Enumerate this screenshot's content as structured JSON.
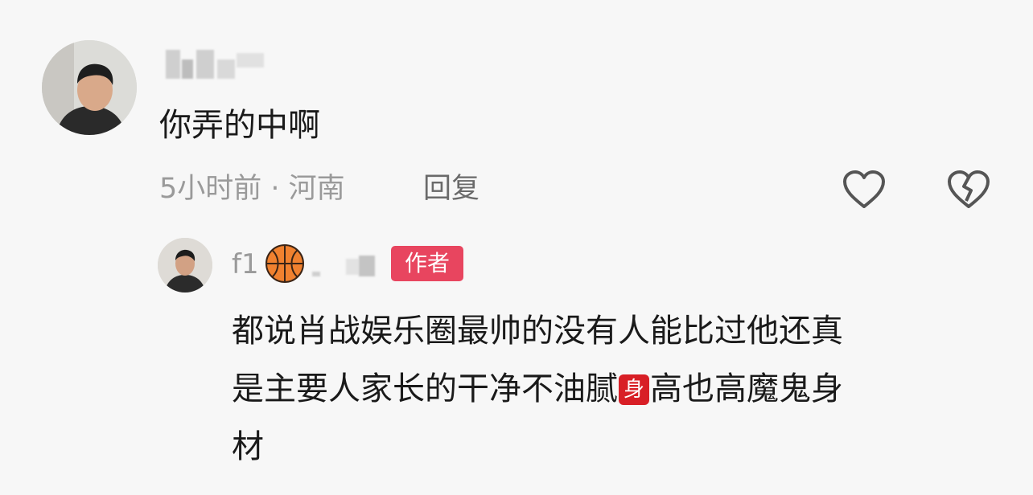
{
  "comment": {
    "text": "你弄的中啊",
    "time_location": "5小时前 · 河南",
    "reply_label": "回复",
    "like_icon": "heart-outline-icon",
    "dislike_icon": "broken-heart-icon"
  },
  "reply": {
    "username_prefix": "f1",
    "username_icon": "basketball-icon",
    "author_badge": "作者",
    "line1": "都说肖战娱乐圈最帅的没有人能比过他还真",
    "line2_before": "是主要人家长的干净不油腻",
    "inline_badge": "身",
    "line2_after": "高也高魔鬼身",
    "line3": "材"
  },
  "colors": {
    "background": "#f7f7f7",
    "author_badge": "#e8455f",
    "inline_badge": "#d81f26",
    "meta_text": "#9a9a9a"
  }
}
